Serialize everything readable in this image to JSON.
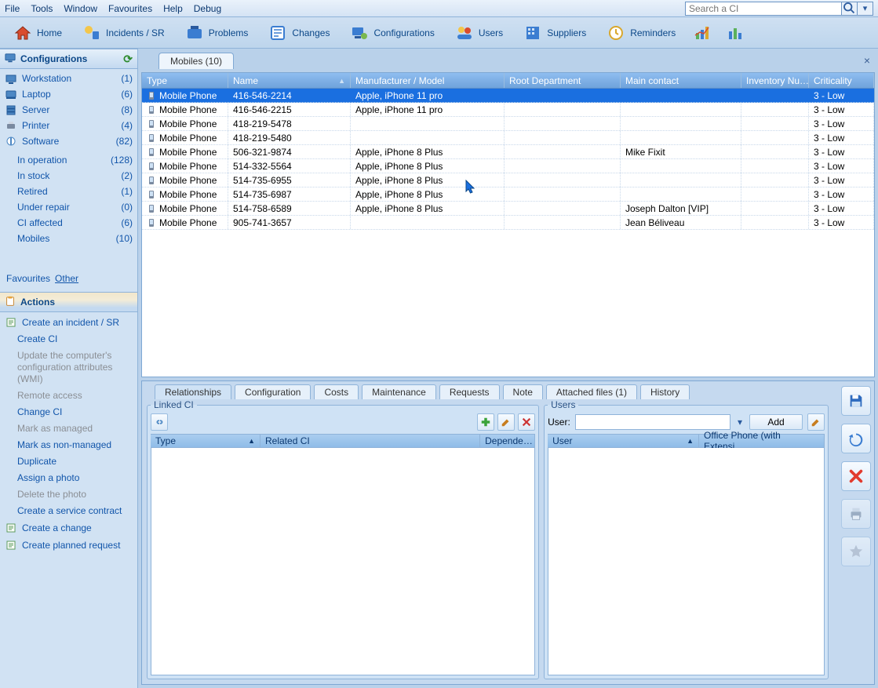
{
  "menu": {
    "items": [
      "File",
      "Tools",
      "Window",
      "Favourites",
      "Help",
      "Debug"
    ]
  },
  "search_placeholder": "Search a CI",
  "toolbar": [
    {
      "name": "home",
      "label": "Home"
    },
    {
      "name": "incidents",
      "label": "Incidents / SR"
    },
    {
      "name": "problems",
      "label": "Problems"
    },
    {
      "name": "changes",
      "label": "Changes"
    },
    {
      "name": "configurations",
      "label": "Configurations"
    },
    {
      "name": "users",
      "label": "Users"
    },
    {
      "name": "suppliers",
      "label": "Suppliers"
    },
    {
      "name": "reminders",
      "label": "Reminders"
    }
  ],
  "sidebar": {
    "config_head": "Configurations",
    "categories": [
      {
        "label": "Workstation",
        "count": "(1)"
      },
      {
        "label": "Laptop",
        "count": "(6)"
      },
      {
        "label": "Server",
        "count": "(8)"
      },
      {
        "label": "Printer",
        "count": "(4)"
      },
      {
        "label": "Software",
        "count": "(82)"
      }
    ],
    "filters": [
      {
        "label": "In operation",
        "count": "(128)"
      },
      {
        "label": "In stock",
        "count": "(2)"
      },
      {
        "label": "Retired",
        "count": "(1)"
      },
      {
        "label": "Under repair",
        "count": "(0)"
      },
      {
        "label": "CI affected",
        "count": "(6)"
      },
      {
        "label": "Mobiles",
        "count": "(10)"
      }
    ],
    "fav": {
      "label": "Favourites",
      "other": "Other"
    },
    "actions_head": "Actions",
    "actions": [
      {
        "label": "Create an incident / SR",
        "disabled": false,
        "icon": true
      },
      {
        "label": "Create CI",
        "disabled": false
      },
      {
        "label": "Update the computer's configuration attributes (WMI)",
        "disabled": true
      },
      {
        "label": "Remote access",
        "disabled": true
      },
      {
        "label": "Change CI",
        "disabled": false
      },
      {
        "label": "Mark as managed",
        "disabled": true
      },
      {
        "label": "Mark as non-managed",
        "disabled": false
      },
      {
        "label": "Duplicate",
        "disabled": false
      },
      {
        "label": "Assign a photo",
        "disabled": false
      },
      {
        "label": "Delete the photo",
        "disabled": true
      },
      {
        "label": "Create a service contract",
        "disabled": false
      },
      {
        "label": "Create a change",
        "disabled": false,
        "icon": true
      },
      {
        "label": "Create planned request",
        "disabled": false,
        "icon": true
      }
    ]
  },
  "tab_label": "Mobiles (10)",
  "grid": {
    "columns": [
      "Type",
      "Name",
      "Manufacturer / Model",
      "Root Department",
      "Main contact",
      "Inventory Nu…",
      "Criticality"
    ],
    "rows": [
      {
        "type": "Mobile Phone",
        "name": "416-546-2214",
        "man": "Apple, iPhone 11 pro",
        "root": "",
        "contact": "",
        "inv": "",
        "crit": "3 - Low",
        "sel": true
      },
      {
        "type": "Mobile Phone",
        "name": "416-546-2215",
        "man": "Apple, iPhone 11 pro",
        "root": "",
        "contact": "",
        "inv": "",
        "crit": "3 - Low"
      },
      {
        "type": "Mobile Phone",
        "name": "418-219-5478",
        "man": "",
        "root": "",
        "contact": "",
        "inv": "",
        "crit": "3 - Low"
      },
      {
        "type": "Mobile Phone",
        "name": "418-219-5480",
        "man": "",
        "root": "",
        "contact": "",
        "inv": "",
        "crit": "3 - Low"
      },
      {
        "type": "Mobile Phone",
        "name": "506-321-9874",
        "man": "Apple, iPhone 8 Plus",
        "root": "",
        "contact": "Mike Fixit",
        "inv": "",
        "crit": "3 - Low"
      },
      {
        "type": "Mobile Phone",
        "name": "514-332-5564",
        "man": "Apple, iPhone 8 Plus",
        "root": "",
        "contact": "",
        "inv": "",
        "crit": "3 - Low"
      },
      {
        "type": "Mobile Phone",
        "name": "514-735-6955",
        "man": "Apple, iPhone 8 Plus",
        "root": "",
        "contact": "",
        "inv": "",
        "crit": "3 - Low"
      },
      {
        "type": "Mobile Phone",
        "name": "514-735-6987",
        "man": "Apple, iPhone 8 Plus",
        "root": "",
        "contact": "",
        "inv": "",
        "crit": "3 - Low"
      },
      {
        "type": "Mobile Phone",
        "name": "514-758-6589",
        "man": "Apple, iPhone 8 Plus",
        "root": "",
        "contact": "Joseph Dalton [VIP]",
        "inv": "",
        "crit": "3 - Low"
      },
      {
        "type": "Mobile Phone",
        "name": "905-741-3657",
        "man": "",
        "root": "",
        "contact": "Jean Béliveau",
        "inv": "",
        "crit": "3 - Low"
      }
    ]
  },
  "detail_tabs": [
    "Relationships",
    "Configuration",
    "Costs",
    "Maintenance",
    "Requests",
    "Note",
    "Attached files (1)",
    "History"
  ],
  "linked": {
    "legend": "Linked CI",
    "cols": [
      "Type",
      "Related CI",
      "Depende…"
    ]
  },
  "users": {
    "legend": "Users",
    "user_label": "User:",
    "add": "Add",
    "cols": [
      "User",
      "Office Phone (with Extensi…"
    ]
  }
}
